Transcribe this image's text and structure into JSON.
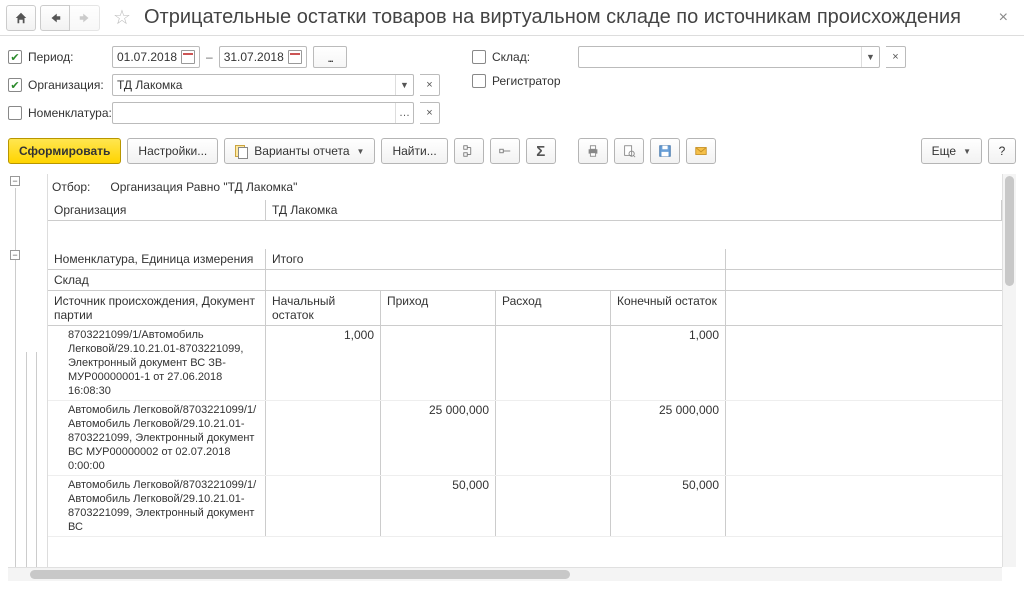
{
  "header": {
    "title": "Отрицательные остатки товаров на виртуальном складе по источникам происхождения"
  },
  "filters": {
    "period_label": "Период:",
    "date_from": "01.07.2018",
    "date_to": "31.07.2018",
    "org_label": "Организация:",
    "org_value": "ТД Лакомка",
    "nomen_label": "Номенклатура:",
    "nomen_value": "",
    "sklad_label": "Склад:",
    "sklad_value": "",
    "registrator_label": "Регистратор"
  },
  "toolbar": {
    "form": "Сформировать",
    "settings": "Настройки...",
    "variants": "Варианты отчета",
    "find": "Найти...",
    "more": "Еще",
    "help": "?"
  },
  "report": {
    "filter_label": "Отбор:",
    "filter_value": "Организация Равно \"ТД Лакомка\"",
    "org_label": "Организация",
    "org_value": "ТД Лакомка",
    "group1": "Номенклатура, Единица измерения",
    "group2": "Склад",
    "group3": "Источник происхождения, Документ партии",
    "itogo": "Итого",
    "cols": {
      "c1": "Начальный остаток",
      "c2": "Приход",
      "c3": "Расход",
      "c4": "Конечный остаток"
    },
    "rows": [
      {
        "label": "8703221099/1/Автомобиль Легковой/29.10.21.01-8703221099, Электронный документ ВС ЗВ-МУР00000001-1 от 27.06.2018 16:08:30",
        "c1": "1,000",
        "c2": "",
        "c3": "",
        "c4": "1,000"
      },
      {
        "label": "Автомобиль Легковой/8703221099/1/Автомобиль Легковой/29.10.21.01-8703221099, Электронный документ ВС МУР00000002 от 02.07.2018 0:00:00",
        "c1": "",
        "c2": "25 000,000",
        "c3": "",
        "c4": "25 000,000"
      },
      {
        "label": "Автомобиль Легковой/8703221099/1/Автомобиль Легковой/29.10.21.01-8703221099, Электронный документ ВС",
        "c1": "",
        "c2": "50,000",
        "c3": "",
        "c4": "50,000"
      }
    ]
  }
}
